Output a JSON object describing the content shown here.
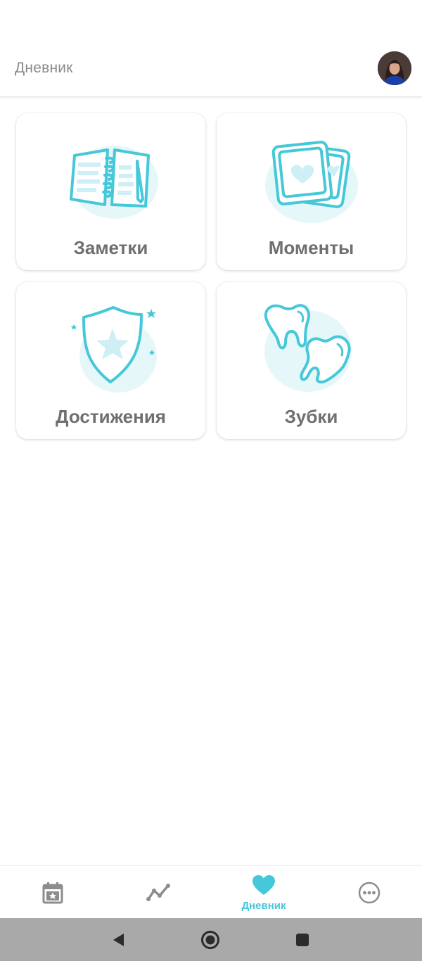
{
  "header": {
    "title": "Дневник"
  },
  "cards": [
    {
      "label": "Заметки",
      "icon": "notebook-icon"
    },
    {
      "label": "Моменты",
      "icon": "photos-icon"
    },
    {
      "label": "Достижения",
      "icon": "shield-star-icon"
    },
    {
      "label": "Зубки",
      "icon": "teeth-icon"
    }
  ],
  "bottom_nav": {
    "items": [
      {
        "icon": "calendar-star-icon",
        "label": "",
        "active": false
      },
      {
        "icon": "chart-line-icon",
        "label": "",
        "active": false
      },
      {
        "icon": "heart-icon",
        "label": "Дневник",
        "active": true
      },
      {
        "icon": "more-icon",
        "label": "",
        "active": false
      }
    ]
  },
  "system_nav": [
    "back-icon",
    "home-icon",
    "recents-icon"
  ],
  "colors": {
    "accent": "#45c8da",
    "accent_light": "#e6f7fa",
    "label_gray": "#6f6f6f",
    "icon_gray": "#8d8d8d",
    "system_bar": "#a9a9a9"
  }
}
